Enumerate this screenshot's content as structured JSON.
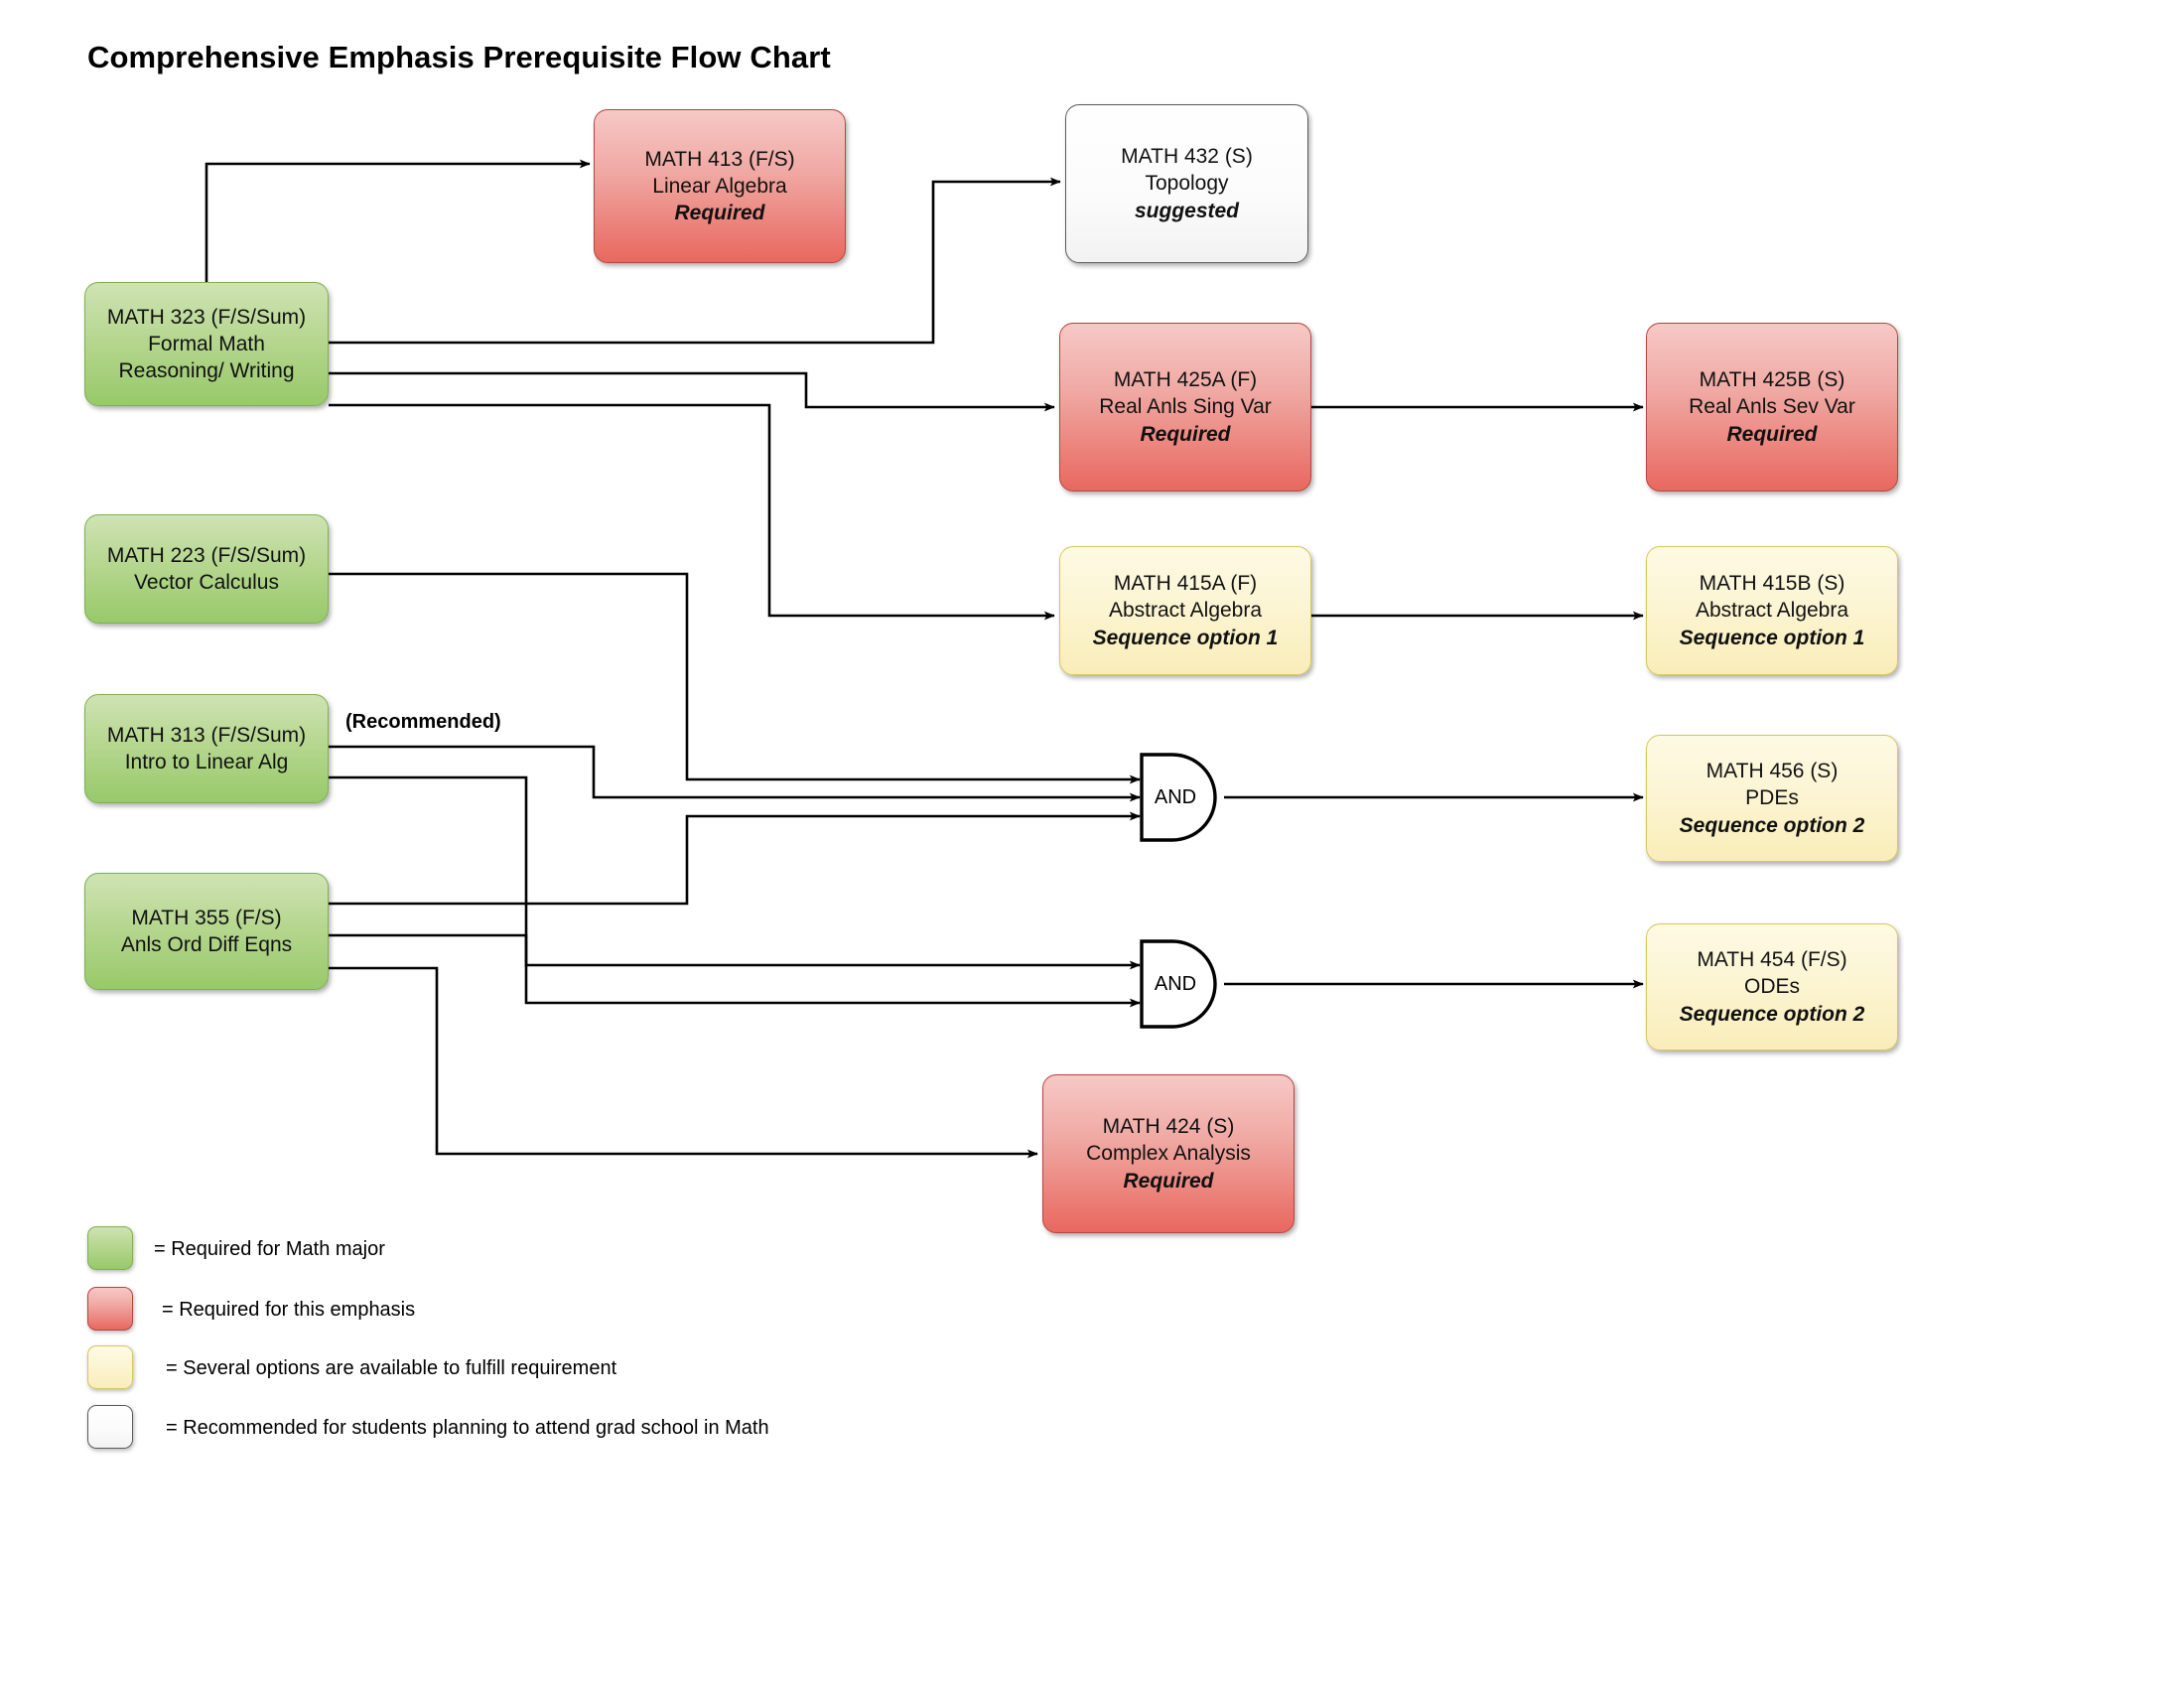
{
  "title": "Comprehensive Emphasis Prerequisite Flow Chart",
  "colors": {
    "green": "#98c96a",
    "red": "#e8685f",
    "cream": "#f9edb9",
    "white": "#ffffff",
    "line": "#000000"
  },
  "annotations": {
    "recommended": "(Recommended)",
    "and_gate_1": "AND",
    "and_gate_2": "AND"
  },
  "nodes": [
    {
      "id": "math413",
      "style": "red",
      "code": "MATH 413 (F/S)",
      "name": "Linear Algebra",
      "status": "Required"
    },
    {
      "id": "math432",
      "style": "white",
      "code": "MATH 432 (S)",
      "name": "Topology",
      "status": "suggested"
    },
    {
      "id": "math323",
      "style": "green",
      "code": "MATH 323 (F/S/Sum)",
      "name": "Formal Math",
      "name2": "Reasoning/ Writing",
      "status": ""
    },
    {
      "id": "math425a",
      "style": "red",
      "code": "MATH 425A (F)",
      "name": "Real Anls Sing Var",
      "status": "Required"
    },
    {
      "id": "math425b",
      "style": "red",
      "code": "MATH 425B (S)",
      "name": "Real Anls Sev Var",
      "status": "Required"
    },
    {
      "id": "math223",
      "style": "green",
      "code": "MATH 223 (F/S/Sum)",
      "name": "Vector Calculus",
      "status": ""
    },
    {
      "id": "math415a",
      "style": "cream",
      "code": "MATH 415A (F)",
      "name": "Abstract Algebra",
      "status": "Sequence option 1"
    },
    {
      "id": "math415b",
      "style": "cream",
      "code": "MATH 415B (S)",
      "name": "Abstract Algebra",
      "status": "Sequence option 1"
    },
    {
      "id": "math313",
      "style": "green",
      "code": "MATH 313 (F/S/Sum)",
      "name": "Intro to Linear Alg",
      "status": ""
    },
    {
      "id": "math456",
      "style": "cream",
      "code": "MATH 456 (S)",
      "name": "PDEs",
      "status": "Sequence option 2"
    },
    {
      "id": "math355",
      "style": "green",
      "code": "MATH 355 (F/S)",
      "name": "Anls Ord Diff Eqns",
      "status": ""
    },
    {
      "id": "math454",
      "style": "cream",
      "code": "MATH 454 (F/S)",
      "name": "ODEs",
      "status": "Sequence option 2"
    },
    {
      "id": "math424",
      "style": "red",
      "code": "MATH 424 (S)",
      "name": "Complex Analysis",
      "status": "Required"
    }
  ],
  "legend": [
    {
      "swatch": "green",
      "text": "= Required for Math major"
    },
    {
      "swatch": "red",
      "text": "= Required for this emphasis"
    },
    {
      "swatch": "cream",
      "text": "= Several options are available to fulfill requirement"
    },
    {
      "swatch": "white",
      "text": "= Recommended for students planning to attend grad school in Math"
    }
  ],
  "edges": [
    {
      "from": "math323",
      "to": "math413"
    },
    {
      "from": "math323",
      "to": "math432"
    },
    {
      "from": "math323",
      "to": "math425a"
    },
    {
      "from": "math323",
      "to": "math415a"
    },
    {
      "from": "math425a",
      "to": "math425b"
    },
    {
      "from": "math415a",
      "to": "math415b"
    },
    {
      "from": "math223",
      "to": "and_gate_1"
    },
    {
      "from": "math313",
      "to": "and_gate_1",
      "label": "(Recommended)"
    },
    {
      "from": "math313",
      "to": "and_gate_2"
    },
    {
      "from": "math355",
      "to": "and_gate_1"
    },
    {
      "from": "math355",
      "to": "and_gate_2"
    },
    {
      "from": "math355",
      "to": "math424"
    },
    {
      "from": "and_gate_1",
      "to": "math456"
    },
    {
      "from": "and_gate_2",
      "to": "math454"
    }
  ]
}
